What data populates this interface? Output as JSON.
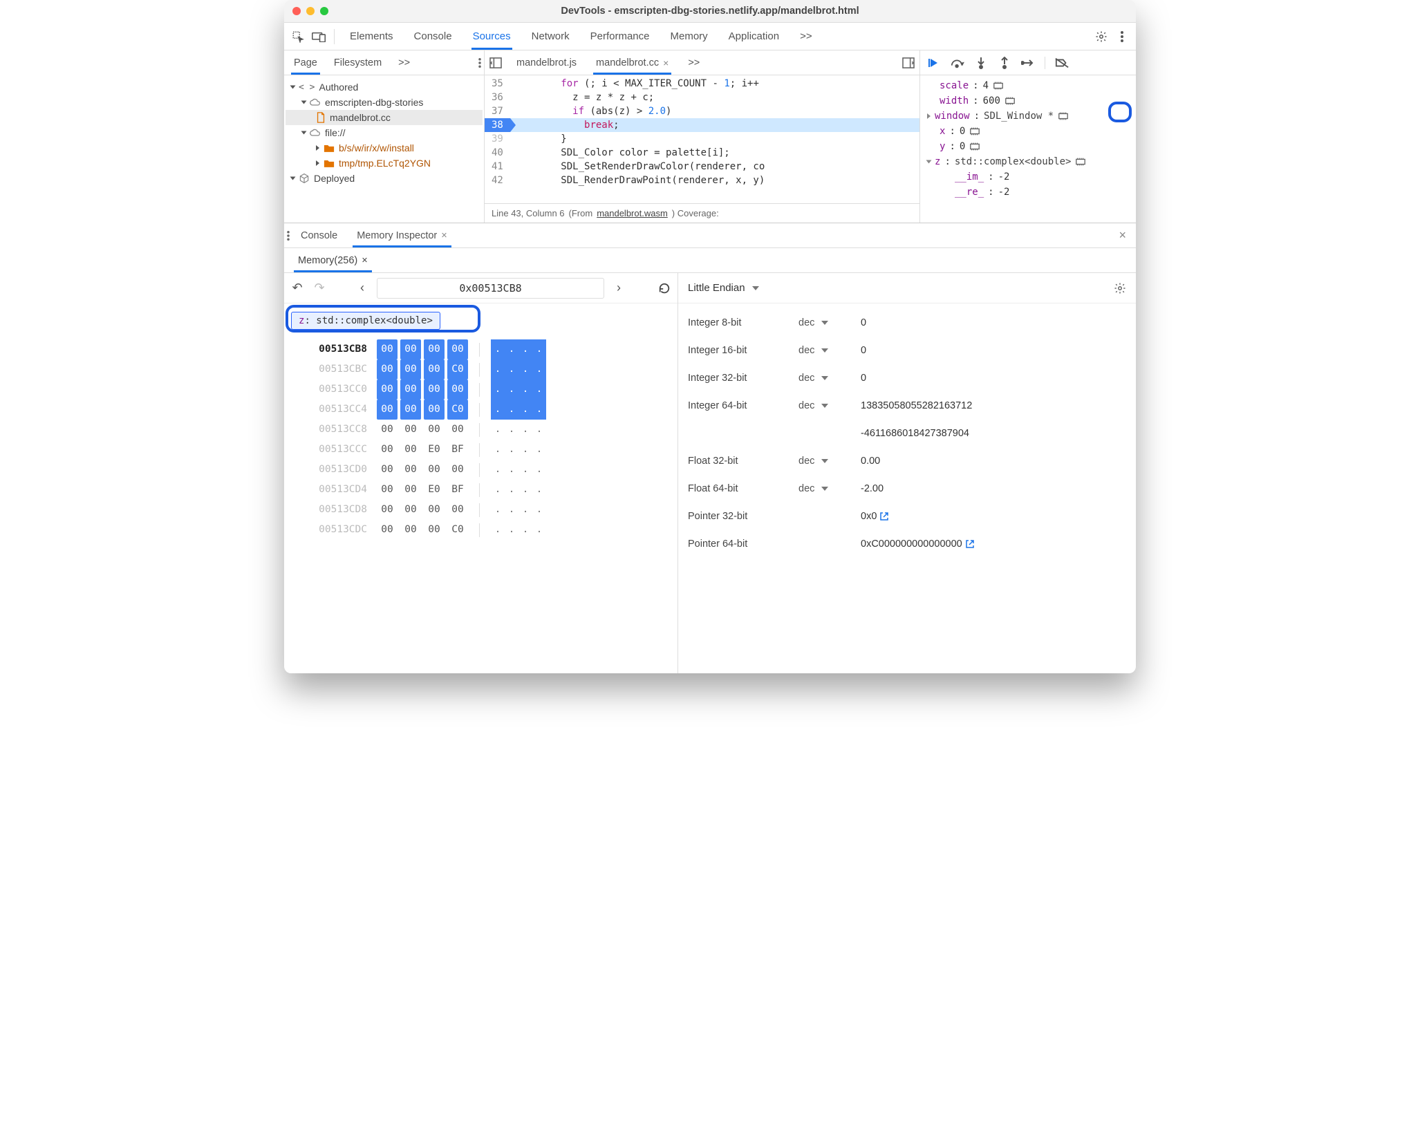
{
  "window": {
    "title": "DevTools - emscripten-dbg-stories.netlify.app/mandelbrot.html"
  },
  "topTabs": {
    "elements": "Elements",
    "console": "Console",
    "sources": "Sources",
    "network": "Network",
    "performance": "Performance",
    "memory": "Memory",
    "application": "Application",
    "more": ">>"
  },
  "leftTabs": {
    "page": "Page",
    "filesystem": "Filesystem",
    "more": ">>"
  },
  "tree": {
    "authored": "Authored",
    "domain": "emscripten-dbg-stories",
    "file1": "mandelbrot.cc",
    "file_scheme": "file://",
    "inst_path": "b/s/w/ir/x/w/install",
    "tmp_path": "tmp/tmp.ELcTq2YGN",
    "deployed": "Deployed"
  },
  "fileTabs": {
    "js": "mandelbrot.js",
    "cc": "mandelbrot.cc",
    "more": ">>"
  },
  "code": {
    "lines": [
      {
        "n": 35,
        "html": "        <span class='kw'>for</span> (; i < MAX_ITER_COUNT - <span class='num'>1</span>; i++"
      },
      {
        "n": 36,
        "html": "          z <span class='ident'>=</span> z <span class='ident'>*</span> z <span class='ident'>+</span> c;"
      },
      {
        "n": 37,
        "html": "          <span class='kw'>if</span> (abs(z) > <span class='num'>2.0</span>)"
      },
      {
        "n": 38,
        "html": "            <span class='pink'>break</span>;",
        "current": true
      },
      {
        "n": 39,
        "html": "        }",
        "dim": true
      },
      {
        "n": 40,
        "html": "        <span class='type'>SDL_Color</span> color = palette[i];"
      },
      {
        "n": 41,
        "html": "        SDL_SetRenderDrawColor(renderer, co"
      },
      {
        "n": 42,
        "html": "        SDL_RenderDrawPoint(renderer, x, y)"
      }
    ],
    "status_pos": "Line 43, Column 6",
    "status_from": "(From ",
    "status_link": "mandelbrot.wasm",
    "status_cov": ")  Coverage:"
  },
  "scope": {
    "scale": {
      "k": "scale",
      "v": "4"
    },
    "width": {
      "k": "width",
      "v": "600"
    },
    "window": {
      "k": "window",
      "v": "SDL_Window *"
    },
    "x": {
      "k": "x",
      "v": "0"
    },
    "y": {
      "k": "y",
      "v": "0"
    },
    "z": {
      "k": "z",
      "v": "std::complex<double>"
    },
    "im": {
      "k": "__im_",
      "v": "-2"
    },
    "re": {
      "k": "__re_",
      "v": "-2"
    }
  },
  "drawer": {
    "console": "Console",
    "meminsp": "Memory Inspector",
    "memtab": "Memory(256)"
  },
  "mem": {
    "address": "0x00513CB8",
    "chip_k": "z",
    "chip_t": ": std::complex<double>",
    "rows": [
      {
        "a": "00513CB8",
        "b": [
          "00",
          "00",
          "00",
          "00"
        ],
        "sel": true,
        "bold": true
      },
      {
        "a": "00513CBC",
        "b": [
          "00",
          "00",
          "00",
          "C0"
        ],
        "sel": true
      },
      {
        "a": "00513CC0",
        "b": [
          "00",
          "00",
          "00",
          "00"
        ],
        "sel": true
      },
      {
        "a": "00513CC4",
        "b": [
          "00",
          "00",
          "00",
          "C0"
        ],
        "sel": true
      },
      {
        "a": "00513CC8",
        "b": [
          "00",
          "00",
          "00",
          "00"
        ]
      },
      {
        "a": "00513CCC",
        "b": [
          "00",
          "00",
          "E0",
          "BF"
        ]
      },
      {
        "a": "00513CD0",
        "b": [
          "00",
          "00",
          "00",
          "00"
        ]
      },
      {
        "a": "00513CD4",
        "b": [
          "00",
          "00",
          "E0",
          "BF"
        ]
      },
      {
        "a": "00513CD8",
        "b": [
          "00",
          "00",
          "00",
          "00"
        ]
      },
      {
        "a": "00513CDC",
        "b": [
          "00",
          "00",
          "00",
          "C0"
        ]
      }
    ]
  },
  "values": {
    "endian": "Little Endian",
    "fmt": "dec",
    "rows": [
      {
        "n": "Integer 8-bit",
        "fmt": true,
        "v": "0"
      },
      {
        "n": "Integer 16-bit",
        "fmt": true,
        "v": "0"
      },
      {
        "n": "Integer 32-bit",
        "fmt": true,
        "v": "0"
      },
      {
        "n": "Integer 64-bit",
        "fmt": true,
        "v": "13835058055282163712"
      },
      {
        "n": "",
        "fmt": false,
        "v": "-4611686018427387904"
      },
      {
        "n": "Float 32-bit",
        "fmt": true,
        "v": "0.00"
      },
      {
        "n": "Float 64-bit",
        "fmt": true,
        "v": "-2.00"
      },
      {
        "n": "Pointer 32-bit",
        "fmt": false,
        "v": "0x0",
        "ext": true
      },
      {
        "n": "Pointer 64-bit",
        "fmt": false,
        "v": "0xC000000000000000",
        "ext": true
      }
    ]
  }
}
